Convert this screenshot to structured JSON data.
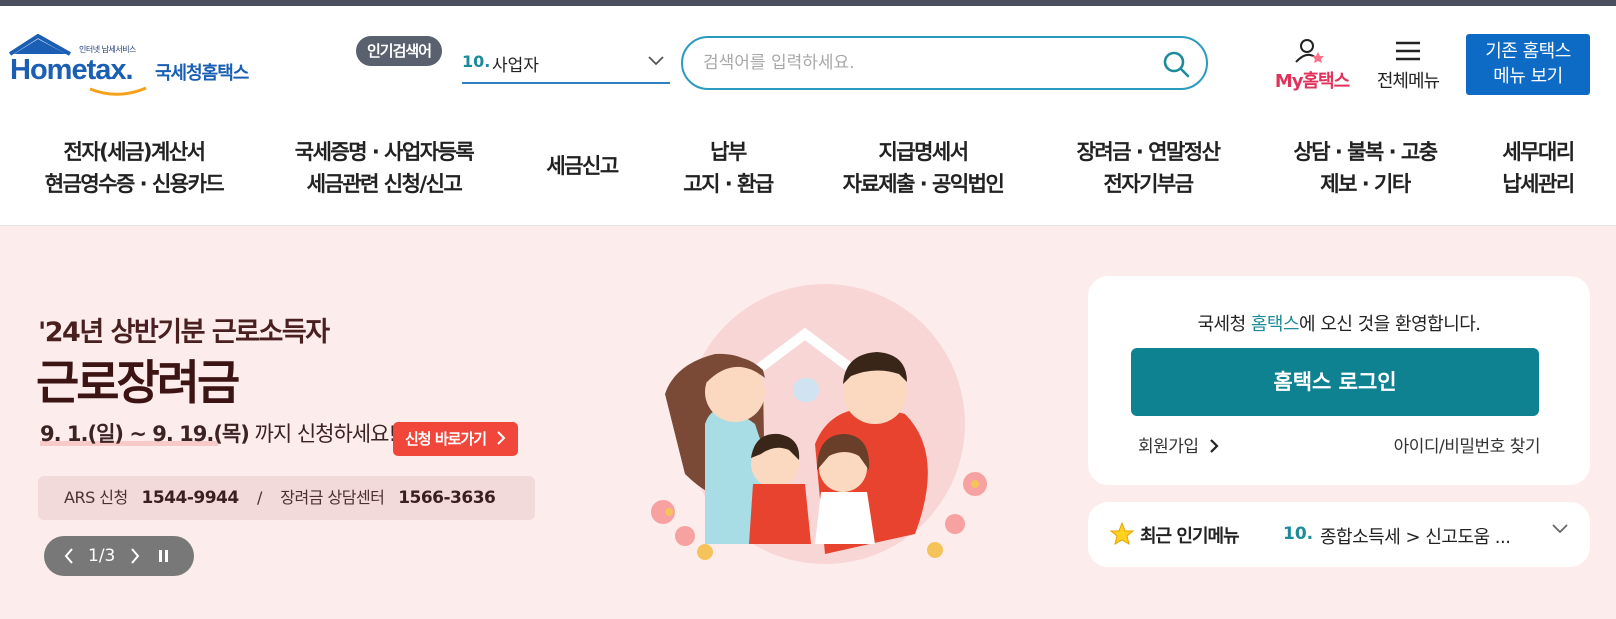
{
  "logo": {
    "tagline": "인터넷 납세서비스",
    "brand": "Hometax.",
    "name": "국세청홈택스"
  },
  "header": {
    "popular_label": "인기검색어",
    "popular_rank": "10.",
    "popular_term": "사업자",
    "search_placeholder": "검색어를 입력하세요.",
    "my_label": "My홈택스",
    "menu_label": "전체메뉴",
    "legacy_line1": "기존 홈택스",
    "legacy_line2": "메뉴 보기"
  },
  "gnb": [
    {
      "line1": "전자(세금)계산서",
      "line2": "현금영수증 · 신용카드"
    },
    {
      "line1": "국세증명 · 사업자등록",
      "line2": "세금관련 신청/신고"
    },
    {
      "line1": "세금신고",
      "line2": ""
    },
    {
      "line1": "납부",
      "line2": "고지 · 환급"
    },
    {
      "line1": "지급명세서",
      "line2": "자료제출 · 공익법인"
    },
    {
      "line1": "장려금 · 연말정산",
      "line2": "전자기부금"
    },
    {
      "line1": "상담 · 불복 · 고충",
      "line2": "제보 · 기타"
    },
    {
      "line1": "세무대리",
      "line2": "납세관리"
    }
  ],
  "banner": {
    "kicker": "'24년 상반기분 근로소득자",
    "headline": "근로장려금",
    "period": "9. 1.(일) ~ 9. 19.(목)",
    "period_suffix": " 까지 신청하세요!",
    "apply_label": "신청 바로가기",
    "ars_label": "ARS 신청",
    "ars_number": "1544-9944",
    "sep": "/",
    "center_label": "장려금 상담센터",
    "center_number": "1566-3636",
    "pager_text": "1/3"
  },
  "login": {
    "welcome_pre": "국세청 ",
    "welcome_hl": "홈택스",
    "welcome_post": "에 오신 것을 환영합니다.",
    "login_label": "홈택스 로그인",
    "join_label": "회원가입",
    "find_label": "아이디/비밀번호 찾기"
  },
  "recent": {
    "title": "최근 인기메뉴",
    "rank": "10.",
    "path": "종합소득세 > 신고도움 ..."
  },
  "colors": {
    "brand": "#1a5fb4",
    "teal": "#0e8290",
    "accent_red": "#f0473a",
    "my_pink": "#e0325a",
    "hero_bg": "#fcecec"
  },
  "icons": [
    "house-logo-icon",
    "chevron-down-icon",
    "search-icon",
    "user-icon",
    "hamburger-icon",
    "chevron-right-icon",
    "pause-icon",
    "star-icon"
  ]
}
